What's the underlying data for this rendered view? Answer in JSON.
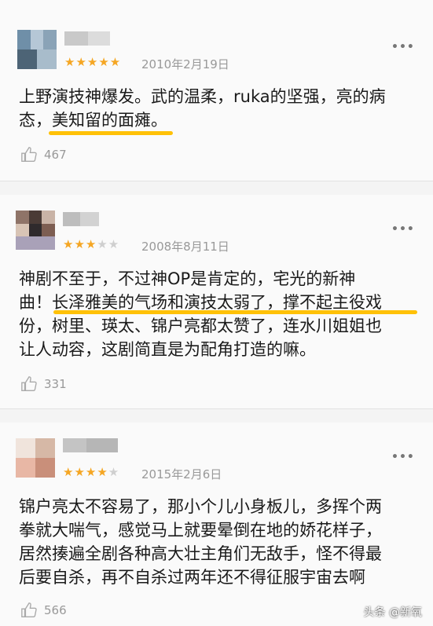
{
  "reviews": [
    {
      "date": "2010年2月19日",
      "stars": 5,
      "lines": [
        "上野演技神爆发。武的温柔，ruka的坚强，亮的病",
        "态，美知留的面瘫。"
      ],
      "likes": "467"
    },
    {
      "date": "2008年8月11日",
      "stars": 3,
      "lines": [
        "神剧不至于，不过神OP是肯定的，宅光的新神",
        "曲！长泽雅美的气场和演技太弱了，撑不起主役戏",
        "份，树里、瑛太、锦户亮都太赞了，连水川姐姐也",
        "让人动容，这剧简直是为配角打造的嘛。"
      ],
      "likes": "331"
    },
    {
      "date": "2015年2月6日",
      "stars": 4,
      "lines": [
        "锦户亮太不容易了，那小个儿小身板儿，多挥个两",
        "拳就大喘气，感觉马上就要晕倒在地的娇花样子，",
        "居然揍遍全剧各种高大壮主角们无敌手，怪不得最",
        "后要自杀，再不自杀过两年还不得征服宇宙去啊"
      ],
      "likes": "566"
    }
  ],
  "more_label": "•••",
  "star_icon": "star-icon",
  "like_icon": "thumbs-up-icon",
  "watermark": "头条 @新氧",
  "colors": {
    "accent": "#f5a623",
    "highlight": "#ffc107"
  }
}
